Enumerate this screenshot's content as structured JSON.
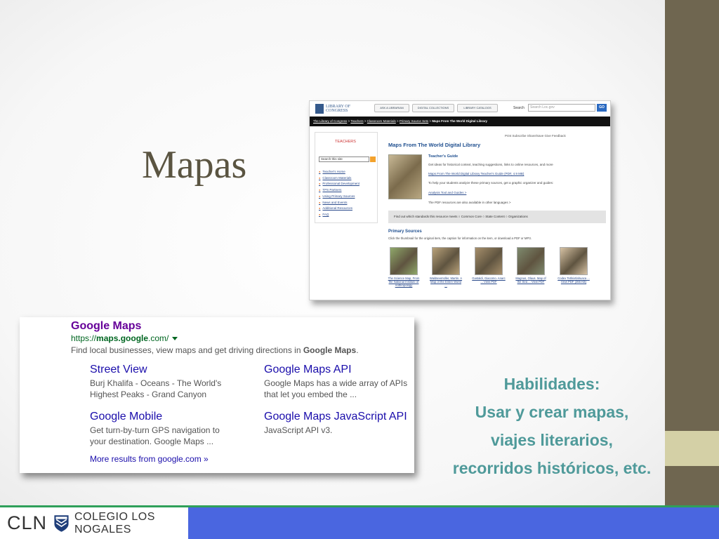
{
  "slide": {
    "title": "Mapas",
    "skills_heading": "Habilidades:",
    "skills_lines": [
      "Usar y crear mapas,",
      "viajes literarios,",
      "recorridos históricos, etc."
    ]
  },
  "footer": {
    "abbr": "CLN",
    "school": "COLEGIO LOS NOGALES"
  },
  "loc": {
    "logo": "LIBRARY OF CONGRESS",
    "tabs": [
      "ASK A LIBRARIAN",
      "DIGITAL COLLECTIONS",
      "LIBRARY CATALOGS"
    ],
    "search_label": "Search",
    "search_placeholder": "Search Loc.gov",
    "go": "GO",
    "breadcrumb": [
      "The Library of Congress",
      "Teachers",
      "Classroom Materials",
      "Primary Source Sets",
      "Maps From The World Digital Library"
    ],
    "sidebar_heading": "TEACHERS",
    "site_search": "Search this site",
    "nav": [
      "Teacher's Home",
      "Classroom Materials",
      "Professional Development",
      "TPS Partners",
      "Using Primary Sources",
      "News and Events",
      "Additional Resources",
      "FAQ"
    ],
    "util": "Print   Subscribe   Share/Save   Give Feedback",
    "page_title": "Maps From The World Digital Library",
    "guide_title": "Teacher's Guide",
    "guide_lines": [
      "Get ideas for historical context, teaching suggestions, links to online resources, and more",
      "Maps From The World Digital Library Teacher's Guide (PDF, 4.9 MB)",
      "To help your students analyze these primary sources, get a graphic organizer and guides:",
      "Analysis Tool and Guides >",
      "The PDF resources are also available in other languages >"
    ],
    "standards": "Find out which standards this resource meets   ○ Common Core   ○ State Content   ○ Organizations",
    "primary_title": "Primary Sources",
    "primary_desc": "Click the thumbnail for the original item, the caption for information on the item, or download a PDF or MP3.",
    "thumbs": [
      {
        "caption": "The Science Map, From the National Institute of Anthropology",
        "color": "#8fa86a"
      },
      {
        "caption": "Waldseemüller, Martin. A Map of the Entire World ...",
        "color": "#b9a27a"
      },
      {
        "caption": "Gastaldi, Giacomo. Anarc ... View PDF",
        "color": "#a68f6b"
      },
      {
        "caption": "Magnus, Olaus. Map of the Sea ... View PDF",
        "color": "#7e8a6e"
      },
      {
        "caption": "Codex Tetlnixtlahuaca ... View PDF (266 KB)",
        "color": "#d6c2a4"
      }
    ]
  },
  "google": {
    "title": "Google Maps",
    "url_prefix": "https://",
    "url_bold": "maps.google",
    "url_suffix": ".com/",
    "desc_prefix": "Find local businesses, view maps and get driving directions in ",
    "desc_bold": "Google Maps",
    "desc_suffix": ".",
    "sitelinks": [
      {
        "title": "Street View",
        "desc": "Burj Khalifa - Oceans - The World's Highest Peaks - Grand Canyon"
      },
      {
        "title": "Google Maps API",
        "desc": "Google Maps has a wide array of APIs that let you embed the ..."
      },
      {
        "title": "Google Mobile",
        "desc": "Get turn-by-turn GPS navigation to your destination. Google Maps ..."
      },
      {
        "title": "Google Maps JavaScript API",
        "desc": "JavaScript API v3."
      }
    ],
    "more": "More results from google.com »"
  },
  "colors": {
    "title": "#5a5441",
    "skills": "#4f9a9a",
    "footer": "#4a66e0",
    "side_bar": "#6f6650"
  }
}
